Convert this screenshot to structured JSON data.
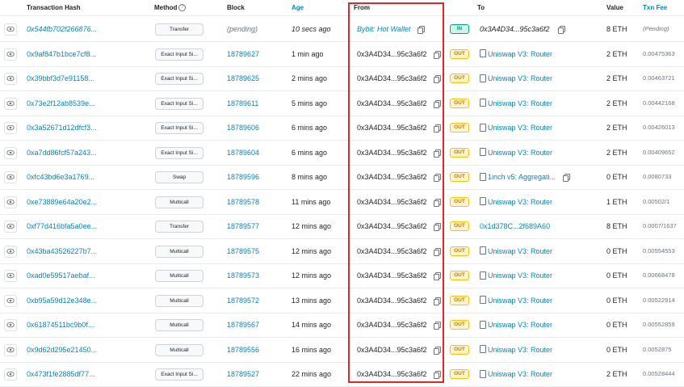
{
  "columns": {
    "hash": "Transaction Hash",
    "method": "Method",
    "block": "Block",
    "age": "Age",
    "from": "From",
    "to": "To",
    "value": "Value",
    "fee": "Txn Fee"
  },
  "rows": [
    {
      "hash": "0x544fb702f266876...",
      "method": "Transfer",
      "block": "(pending)",
      "age": "10 secs ago",
      "from": "Bybit: Hot Wallet",
      "dir": "IN",
      "to": "0x3A4D34...95c3a6f2",
      "value": "8 ETH",
      "fee": "(Pending)",
      "pending": true,
      "fromNamed": true,
      "toContract": false
    },
    {
      "hash": "0x9af847b1bce7cf8...",
      "method": "Exact Input Si...",
      "block": "18789627",
      "age": "1 min ago",
      "from": "0x3A4D34...95c3a6f2",
      "dir": "OUT",
      "to": "Uniswap V3: Router",
      "value": "2 ETH",
      "fee": "0.00475363",
      "toContract": true
    },
    {
      "hash": "0x39bbf3d7e91158...",
      "method": "Exact Input Si...",
      "block": "18789625",
      "age": "2 mins ago",
      "from": "0x3A4D34...95c3a6f2",
      "dir": "OUT",
      "to": "Uniswap V3: Router",
      "value": "2 ETH",
      "fee": "0.00463721",
      "toContract": true
    },
    {
      "hash": "0x73e2f12ab8539e...",
      "method": "Exact Input Si...",
      "block": "18789611",
      "age": "5 mins ago",
      "from": "0x3A4D34...95c3a6f2",
      "dir": "OUT",
      "to": "Uniswap V3: Router",
      "value": "2 ETH",
      "fee": "0.00442168",
      "toContract": true
    },
    {
      "hash": "0x3a52671d12dfcf3...",
      "method": "Exact Input Si...",
      "block": "18789606",
      "age": "6 mins ago",
      "from": "0x3A4D34...95c3a6f2",
      "dir": "OUT",
      "to": "Uniswap V3: Router",
      "value": "2 ETH",
      "fee": "0.00426013",
      "toContract": true
    },
    {
      "hash": "0xa7dd86fcf57a243...",
      "method": "Exact Input Si...",
      "block": "18789604",
      "age": "6 mins ago",
      "from": "0x3A4D34...95c3a6f2",
      "dir": "OUT",
      "to": "Uniswap V3: Router",
      "value": "2 ETH",
      "fee": "0.00409652",
      "toContract": true
    },
    {
      "hash": "0xfc43bd6e3a1769...",
      "method": "Swap",
      "block": "18789596",
      "age": "8 mins ago",
      "from": "0x3A4D34...95c3a6f2",
      "dir": "OUT",
      "to": "1inch v5: Aggregati...",
      "value": "0 ETH",
      "fee": "0.0080733",
      "toContract": true,
      "copyTo": true
    },
    {
      "hash": "0xe73889e64a20e2...",
      "method": "Multicall",
      "block": "18789578",
      "age": "11 mins ago",
      "from": "0x3A4D34...95c3a6f2",
      "dir": "OUT",
      "to": "Uniswap V3: Router",
      "value": "1 ETH",
      "fee": "0.00502/1",
      "toContract": true
    },
    {
      "hash": "0xf77d416bfa5a0ee...",
      "method": "Transfer",
      "block": "18789577",
      "age": "12 mins ago",
      "from": "0x3A4D34...95c3a6f2",
      "dir": "OUT",
      "to": "0x1d378C...2f689A60",
      "value": "8 ETH",
      "fee": "0.0007/1637",
      "toContract": false,
      "toLink": true
    },
    {
      "hash": "0x43ba43526227b7...",
      "method": "Multicall",
      "block": "18789575",
      "age": "12 mins ago",
      "from": "0x3A4D34...95c3a6f2",
      "dir": "OUT",
      "to": "Uniswap V3: Router",
      "value": "0 ETH",
      "fee": "0.00554553",
      "toContract": true
    },
    {
      "hash": "0xad0e59517aebaf...",
      "method": "Multicall",
      "block": "18789573",
      "age": "12 mins ago",
      "from": "0x3A4D34...95c3a6f2",
      "dir": "OUT",
      "to": "Uniswap V3: Router",
      "value": "0 ETH",
      "fee": "0.00668478",
      "toContract": true
    },
    {
      "hash": "0xb95a59d12e348e...",
      "method": "Multicall",
      "block": "18789572",
      "age": "13 mins ago",
      "from": "0x3A4D34...95c3a6f2",
      "dir": "OUT",
      "to": "Uniswap V3: Router",
      "value": "0 ETH",
      "fee": "0.00522914",
      "toContract": true
    },
    {
      "hash": "0x61874511bc9b0f...",
      "method": "Multicall",
      "block": "18789567",
      "age": "14 mins ago",
      "from": "0x3A4D34...95c3a6f2",
      "dir": "OUT",
      "to": "Uniswap V3: Router",
      "value": "0 ETH",
      "fee": "0.00552859",
      "toContract": true
    },
    {
      "hash": "0x9d62d295e21450...",
      "method": "Multicall",
      "block": "18789556",
      "age": "16 mins ago",
      "from": "0x3A4D34...95c3a6f2",
      "dir": "OUT",
      "to": "Uniswap V3: Router",
      "value": "0 ETH",
      "fee": "0.0052875",
      "toContract": true
    },
    {
      "hash": "0x473f1fe2885df77...",
      "method": "Exact Input Si...",
      "block": "18789527",
      "age": "22 mins ago",
      "from": "0x3A4D34...95c3a6f2",
      "dir": "OUT",
      "to": "Uniswap V3: Router",
      "value": "2 ETH",
      "fee": "0.00528444",
      "toContract": true
    }
  ],
  "colors": {
    "link": "#0784c3",
    "highlight": "#e0262b",
    "out_badge": "#fff3cd",
    "in_badge": "#d1f3e8"
  },
  "icons": {
    "row_detail": "eye-icon",
    "copy": "copy-icon",
    "contract": "document-icon",
    "help": "question-icon"
  }
}
